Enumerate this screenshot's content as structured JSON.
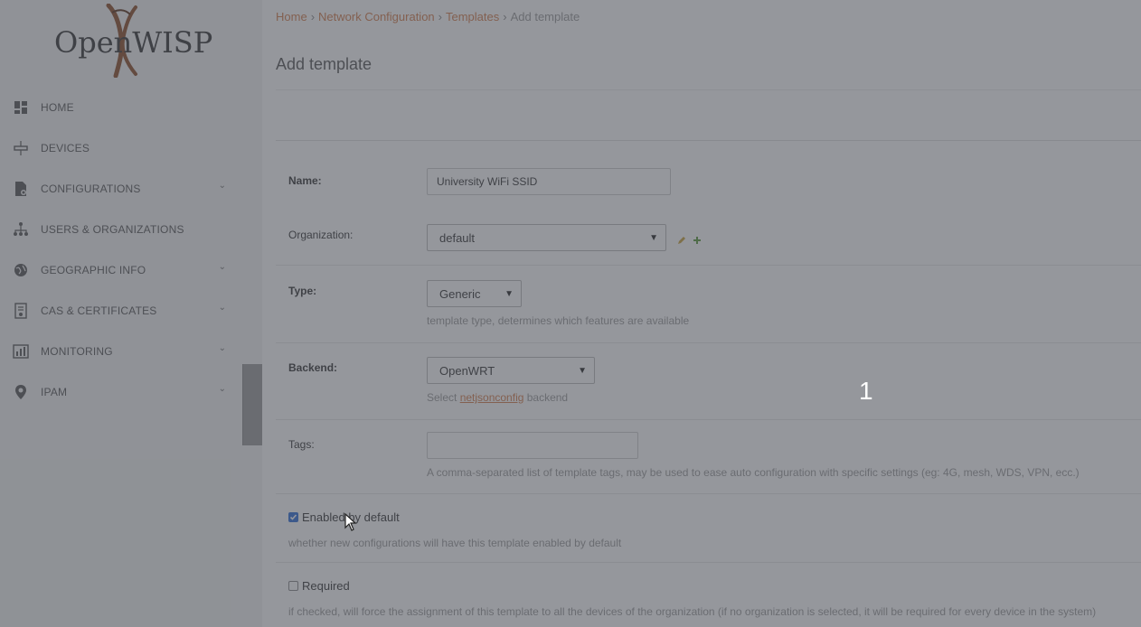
{
  "app": {
    "logo_text": "OpenWISP"
  },
  "sidebar": {
    "items": [
      {
        "label": "HOME",
        "icon": "dashboard-icon",
        "has_chevron": false
      },
      {
        "label": "DEVICES",
        "icon": "devices-icon",
        "has_chevron": false
      },
      {
        "label": "CONFIGURATIONS",
        "icon": "configurations-icon",
        "has_chevron": true
      },
      {
        "label": "USERS & ORGANIZATIONS",
        "icon": "users-organizations-icon",
        "has_chevron": false
      },
      {
        "label": "GEOGRAPHIC INFO",
        "icon": "globe-icon",
        "has_chevron": true
      },
      {
        "label": "CAS & CERTIFICATES",
        "icon": "certificate-icon",
        "has_chevron": true
      },
      {
        "label": "MONITORING",
        "icon": "monitoring-icon",
        "has_chevron": true
      },
      {
        "label": "IPAM",
        "icon": "location-pin-icon",
        "has_chevron": true
      }
    ]
  },
  "breadcrumb": {
    "home": "Home",
    "network_configuration": "Network Configuration",
    "templates": "Templates",
    "current": "Add template",
    "separator": "›"
  },
  "page": {
    "title": "Add template"
  },
  "form": {
    "name": {
      "label": "Name:",
      "value": "University WiFi SSID"
    },
    "organization": {
      "label": "Organization:",
      "value": "default"
    },
    "type": {
      "label": "Type:",
      "value": "Generic",
      "help": "template type, determines which features are available"
    },
    "backend": {
      "label": "Backend:",
      "value": "OpenWRT",
      "help_prefix": "Select ",
      "help_link": "netjsonconfig",
      "help_suffix": " backend"
    },
    "tags": {
      "label": "Tags:",
      "value": "",
      "help": "A comma-separated list of template tags, may be used to ease auto configuration with specific settings (eg: 4G, mesh, WDS, VPN, ecc.)"
    },
    "default": {
      "label": "Enabled by default",
      "checked": true,
      "help": "whether new configurations will have this template enabled by default"
    },
    "required": {
      "label": "Required",
      "checked": false,
      "help": "if checked, will force the assignment of this template to all the devices of the organization (if no organization is selected, it will be required for every device in the system)"
    }
  },
  "overlay": {
    "step_number": "1"
  },
  "colors": {
    "accent": "#d57d4b",
    "checkbox_checked": "#2d6bd6"
  }
}
